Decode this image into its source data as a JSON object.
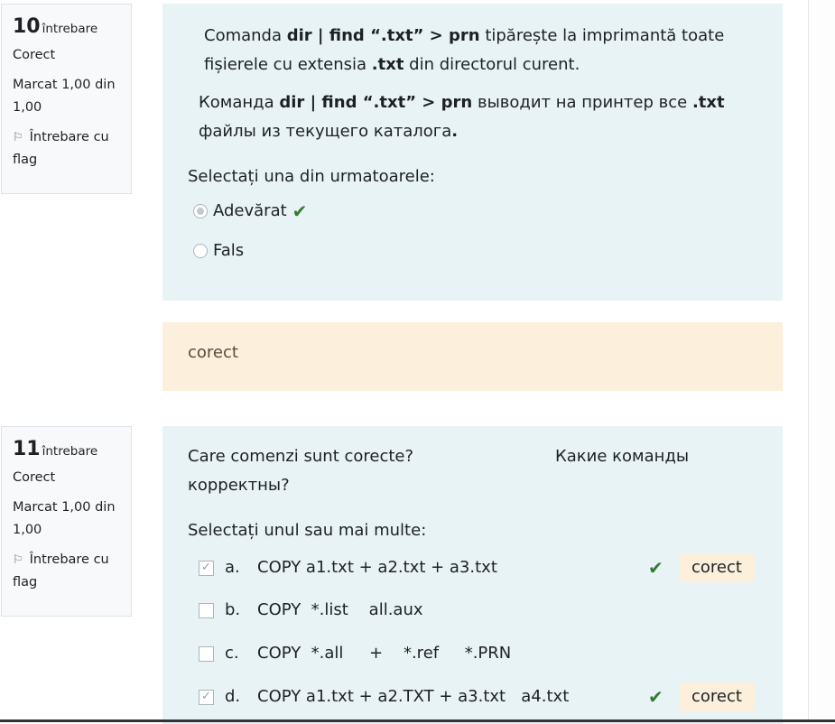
{
  "q10": {
    "number": "10",
    "word": "întrebare",
    "state": "Corect",
    "grade": "Marcat 1,00 din 1,00",
    "flag": "Întrebare cu flag",
    "text_ro": {
      "t1": "Comanda ",
      "cmd1": "dir | find  “.txt” > prn",
      "t2": " tipărește la imprimantă toate fișierele cu extensia ",
      "ext": ".txt",
      "t3": " din directorul curent."
    },
    "text_ru": {
      "t1": "Команда ",
      "cmd1": "dir | find  “.txt” > prn",
      "t2": " выводит на принтер все ",
      "ext": ".txt",
      "t3": " файлы из текущего каталога",
      "dot": "."
    },
    "prompt": "Selectați una din urmatoarele:",
    "options": [
      {
        "label": "Adevărat",
        "selected": true,
        "correct_mark": true
      },
      {
        "label": "Fals",
        "selected": false,
        "correct_mark": false
      }
    ],
    "feedback": "corect"
  },
  "q11": {
    "number": "11",
    "word": "întrebare",
    "state": "Corect",
    "grade": "Marcat 1,00 din 1,00",
    "flag": "Întrebare cu flag",
    "question_ro": "Care comenzi sunt corecte?",
    "question_ru": "Какие команды корректны?",
    "prompt": "Selectați unul sau mai multe:",
    "options": [
      {
        "letter": "a.",
        "text": "COPY a1.txt + a2.txt + a3.txt",
        "checked": true,
        "badge": "corect"
      },
      {
        "letter": "b.",
        "text": "COPY  *.list    all.aux",
        "checked": false,
        "badge": ""
      },
      {
        "letter": "c.",
        "text": "COPY  *.all     +    *.ref     *.PRN",
        "checked": false,
        "badge": ""
      },
      {
        "letter": "d.",
        "text": "COPY a1.txt + a2.TXT + a3.txt   a4.txt",
        "checked": true,
        "badge": "corect"
      }
    ]
  },
  "colors": {
    "question_bg": "#e7f3f5",
    "feedback_bg": "#fcefdc",
    "correct_check": "#357a32"
  }
}
